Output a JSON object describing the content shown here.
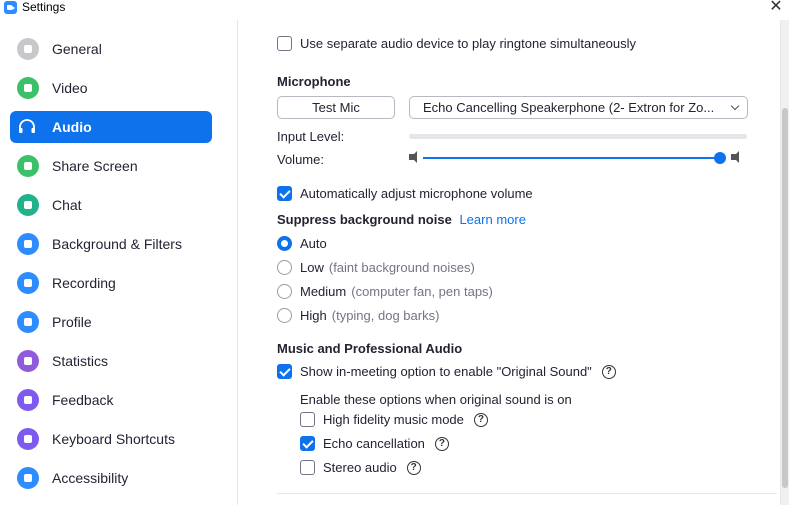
{
  "window": {
    "title": "Settings",
    "close_glyph": "✕"
  },
  "sidebar": {
    "items": [
      {
        "label": "General",
        "icon": "gear-icon",
        "active": false
      },
      {
        "label": "Video",
        "icon": "video-camera-icon",
        "active": false
      },
      {
        "label": "Audio",
        "icon": "headphones-icon",
        "active": true
      },
      {
        "label": "Share Screen",
        "icon": "share-screen-icon",
        "active": false
      },
      {
        "label": "Chat",
        "icon": "chat-bubble-icon",
        "active": false
      },
      {
        "label": "Background & Filters",
        "icon": "person-background-icon",
        "active": false
      },
      {
        "label": "Recording",
        "icon": "record-icon",
        "active": false
      },
      {
        "label": "Profile",
        "icon": "person-icon",
        "active": false
      },
      {
        "label": "Statistics",
        "icon": "bar-chart-icon",
        "active": false
      },
      {
        "label": "Feedback",
        "icon": "smiley-icon",
        "active": false
      },
      {
        "label": "Keyboard Shortcuts",
        "icon": "keyboard-icon",
        "active": false
      },
      {
        "label": "Accessibility",
        "icon": "accessibility-icon",
        "active": false
      }
    ]
  },
  "audio": {
    "ringtone_option": {
      "label": "Use separate audio device to play ringtone simultaneously",
      "checked": false
    },
    "microphone": {
      "heading": "Microphone",
      "test_button": "Test Mic",
      "device": "Echo Cancelling Speakerphone (2- Extron for Zo...",
      "input_level_label": "Input Level:",
      "volume_label": "Volume:",
      "volume_fraction": 0.99
    },
    "auto_adjust": {
      "label": "Automatically adjust microphone volume",
      "checked": true
    },
    "suppress": {
      "heading": "Suppress background noise",
      "learn_more": "Learn more",
      "options": [
        {
          "label": "Auto",
          "hint": "",
          "selected": true
        },
        {
          "label": "Low",
          "hint": "(faint background noises)",
          "selected": false
        },
        {
          "label": "Medium",
          "hint": "(computer fan, pen taps)",
          "selected": false
        },
        {
          "label": "High",
          "hint": "(typing, dog barks)",
          "selected": false
        }
      ]
    },
    "music": {
      "heading": "Music and Professional Audio",
      "original_sound": {
        "label": "Show in-meeting option to enable \"Original Sound\"",
        "checked": true
      },
      "sub_heading": "Enable these options when original sound is on",
      "sub_options": [
        {
          "label": "High fidelity music mode",
          "checked": false
        },
        {
          "label": "Echo cancellation",
          "checked": true
        },
        {
          "label": "Stereo audio",
          "checked": false
        }
      ]
    }
  },
  "colors": {
    "accent": "#0E72ED",
    "zoom_blue": "#2D8CFF"
  }
}
